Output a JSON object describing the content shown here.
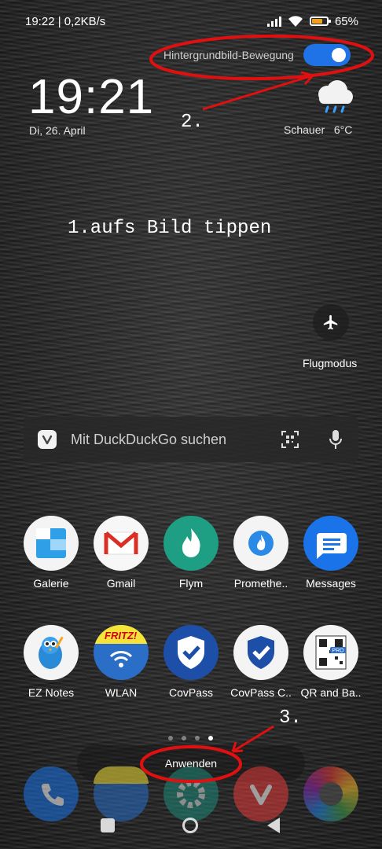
{
  "status_bar": {
    "left_text": "19:22 | 0,2KB/s",
    "battery_percent": "65%",
    "battery_level": 0.65,
    "battery_color": "#f0a11b"
  },
  "wallpaper_toggle": {
    "label": "Hintergrundbild-Bewegung",
    "enabled": true,
    "color": "#1f73e6"
  },
  "clock": {
    "time": "19:21",
    "date": "Di, 26. April"
  },
  "weather": {
    "text": "Schauer   6°C",
    "icon": "rain-cloud-icon"
  },
  "annotations": {
    "step1": "1.aufs Bild tippen",
    "step2": "2.",
    "step3": "3.",
    "color": "#e01010"
  },
  "quick_toggle": {
    "label": "Flugmodus",
    "icon": "airplane-icon"
  },
  "search": {
    "placeholder": "Mit DuckDuckGo suchen"
  },
  "apps_row1": [
    {
      "label": "Galerie"
    },
    {
      "label": "Gmail"
    },
    {
      "label": "Flym"
    },
    {
      "label": "Promethe.."
    },
    {
      "label": "Messages"
    }
  ],
  "apps_row2": [
    {
      "label": "EZ Notes"
    },
    {
      "label": "WLAN"
    },
    {
      "label": "CovPass"
    },
    {
      "label": "CovPass C.."
    },
    {
      "label": "QR and Ba.."
    }
  ],
  "apply_button": {
    "label": "Anwenden"
  },
  "dock": [
    "phone-icon",
    "fritz-fon-icon",
    "settings-icon",
    "vivaldi-icon",
    "browser-icon"
  ],
  "page_indicator": {
    "pages": 4,
    "active": 4
  }
}
